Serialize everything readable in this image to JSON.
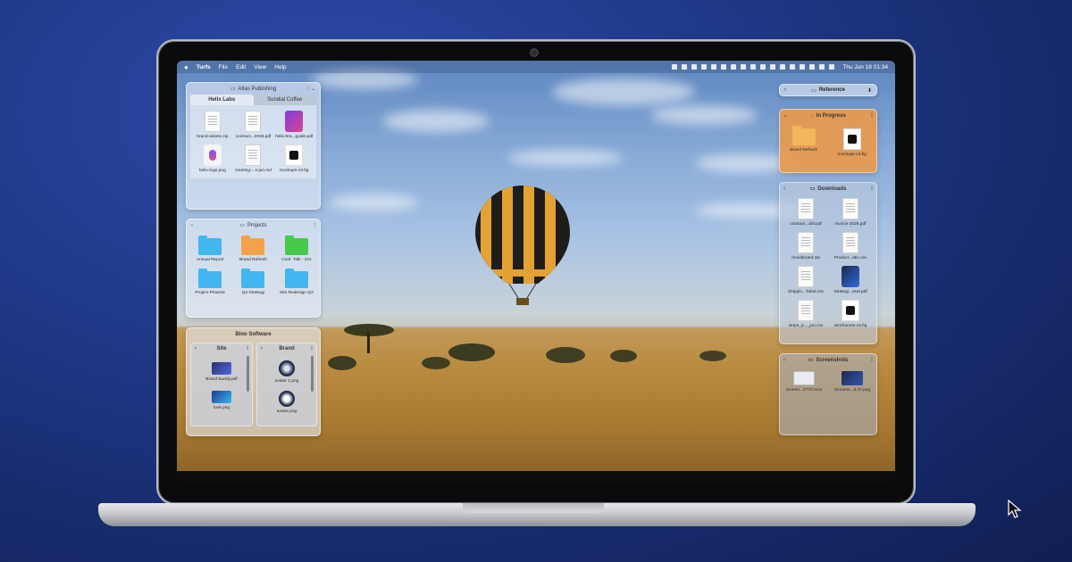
{
  "menubar": {
    "apple": "",
    "items": [
      "Turfs",
      "File",
      "Edit",
      "View",
      "Help"
    ],
    "clock": "Thu Jun 18  01:34"
  },
  "atlas": {
    "title": "Atlas Publishing",
    "tabs": [
      "Helix Labs",
      "Sundial Coffee"
    ],
    "files": [
      "brand-assets.zip",
      "contract...2026.pdf",
      "helix-bra...guide.pdf",
      "helix-logo.png",
      "meeting-...s-jun.md",
      "mockups-v3.fig"
    ]
  },
  "projects": {
    "title": "Projects",
    "folders": [
      "Annual Report",
      "Brand Refresh",
      "Conf. Talk - Oct",
      "Project Phoenix",
      "Q4 Strategy",
      "Site Redesign Q3"
    ]
  },
  "bloo": {
    "title": "Bloo Software",
    "site": {
      "title": "Site",
      "files": [
        "Brand Buddy.pdf",
        "look.png"
      ]
    },
    "brand": {
      "title": "Brand",
      "files": [
        "avatar 1.png",
        "avatar.png"
      ]
    }
  },
  "reference": {
    "title": "Reference"
  },
  "inprogress": {
    "title": "In Progress",
    "files": [
      "Brand Refresh",
      "mockups-v3.fig"
    ]
  },
  "downloads": {
    "title": "Downloads",
    "files": [
      "contract...dal.pdf",
      "invoice 2026.pdf",
      "moodboard.zip",
      "Product...abc.csv",
      "Shippin...Tabel.csv",
      "Strategi...osal.pdf",
      "stripe_p..._jun.csv",
      "wireframes-v3.fig"
    ]
  },
  "screenshots": {
    "title": "Screenshots",
    "files": [
      "Screen...2772.mov",
      "Screens...6.37.png"
    ]
  },
  "colors": {
    "folder_blue": "#41b6f0",
    "folder_orange": "#f3a24a",
    "folder_green": "#49c94a",
    "inprogress_bg": "#e99a4e"
  }
}
